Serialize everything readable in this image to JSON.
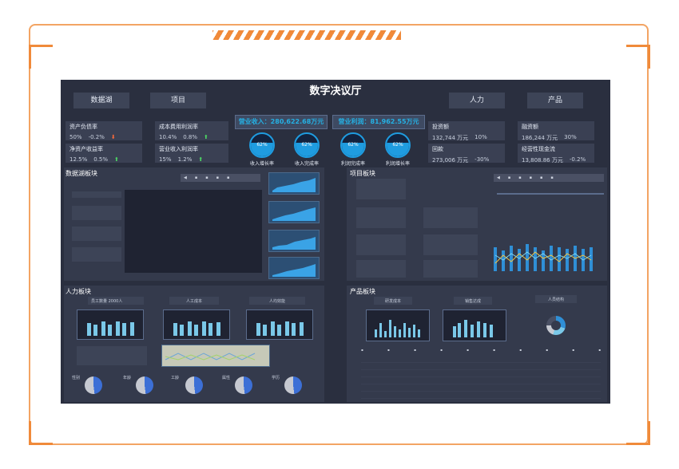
{
  "title": "数字决议厅",
  "nav": {
    "left1": "数据湖",
    "left2": "项目",
    "right1": "人力",
    "right2": "产品"
  },
  "kpis": [
    {
      "t": "资产负债率",
      "v": "50%",
      "d": "-0.2%",
      "dir": "down"
    },
    {
      "t": "成本费用利润率",
      "v": "10.4%",
      "d": "0.8%",
      "dir": "up"
    },
    {
      "t": "净资产收益率",
      "v": "12.5%",
      "d": "0.5%",
      "dir": "up"
    },
    {
      "t": "营业收入利润率",
      "v": "15%",
      "d": "1.2%",
      "dir": "up"
    }
  ],
  "right_kpis": [
    {
      "t": "投资额",
      "v": "132,744 万元",
      "d": "10%"
    },
    {
      "t": "融资额",
      "v": "186,244 万元",
      "d": "30%"
    },
    {
      "t": "回款",
      "v": "273,006 万元",
      "d": "-30%"
    },
    {
      "t": "经营性现金流",
      "v": "13,808.86 万元",
      "d": "-0.2%"
    }
  ],
  "banners": {
    "revenue": "营业收入：280,622.68万元",
    "profit": "营业利润：81,962.55万元"
  },
  "gauges": [
    {
      "label": "收入增长率",
      "pct": "62%"
    },
    {
      "label": "收入完成率",
      "pct": "62%"
    },
    {
      "label": "利润完成率",
      "pct": "62%"
    },
    {
      "label": "利润增长率",
      "pct": "62%"
    }
  ],
  "sections": {
    "datalake": "数据湖板块",
    "project": "项目板块",
    "hr": "人力板块",
    "product": "产品板块"
  },
  "hr": {
    "staff": "员工数量 2000人",
    "cost": "人工成本",
    "efficiency": "人均效能"
  },
  "pies": [
    {
      "label": "性别"
    },
    {
      "label": "年龄"
    },
    {
      "label": "工龄"
    },
    {
      "label": "属性"
    },
    {
      "label": "学历"
    }
  ],
  "pie_pcts": {
    "a": "52%",
    "b": "48%"
  },
  "product": {
    "rd": "研发成本",
    "sales": "销售达成",
    "structure": "人员结构"
  },
  "colors": {
    "accent": "#25b0e3",
    "orange": "#f08a3a"
  }
}
